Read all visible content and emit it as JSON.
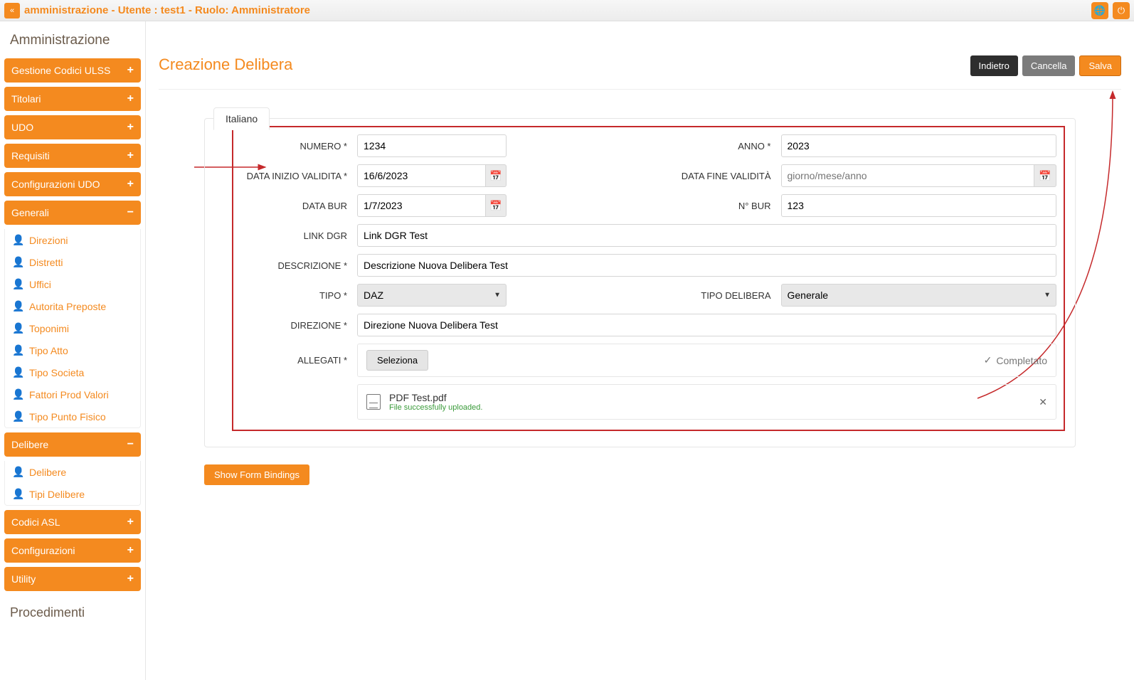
{
  "topbar": {
    "title": "amministrazione - Utente : test1 - Ruolo: Amministratore"
  },
  "sidebar": {
    "heading": "Amministrazione",
    "groups": [
      {
        "label": "Gestione Codici ULSS",
        "expanded": false
      },
      {
        "label": "Titolari",
        "expanded": false
      },
      {
        "label": "UDO",
        "expanded": false
      },
      {
        "label": "Requisiti",
        "expanded": false
      },
      {
        "label": "Configurazioni UDO",
        "expanded": false
      },
      {
        "label": "Generali",
        "expanded": true,
        "items": [
          "Direzioni",
          "Distretti",
          "Uffici",
          "Autorita Preposte",
          "Toponimi",
          "Tipo Atto",
          "Tipo Societa",
          "Fattori Prod Valori",
          "Tipo Punto Fisico"
        ]
      },
      {
        "label": "Delibere",
        "expanded": true,
        "items": [
          "Delibere",
          "Tipi Delibere"
        ]
      },
      {
        "label": "Codici ASL",
        "expanded": false
      },
      {
        "label": "Configurazioni",
        "expanded": false
      },
      {
        "label": "Utility",
        "expanded": false
      }
    ],
    "footer": "Procedimenti"
  },
  "page": {
    "title": "Creazione Delibera",
    "buttons": {
      "back": "Indietro",
      "cancel": "Cancella",
      "save": "Salva"
    },
    "tab": "Italiano",
    "show_bindings": "Show Form Bindings"
  },
  "form": {
    "labels": {
      "numero": "NUMERO *",
      "anno": "ANNO *",
      "data_inizio": "DATA INIZIO VALIDITA *",
      "data_fine": "DATA FINE VALIDITÀ",
      "data_bur": "DATA BUR",
      "n_bur": "N° BUR",
      "link_dgr": "LINK DGR",
      "descrizione": "DESCRIZIONE *",
      "tipo": "TIPO *",
      "tipo_delibera": "TIPO DELIBERA",
      "direzione": "DIREZIONE *",
      "allegati": "ALLEGATI *"
    },
    "values": {
      "numero": "1234",
      "anno": "2023",
      "data_inizio": "16/6/2023",
      "data_fine_placeholder": "giorno/mese/anno",
      "data_bur": "1/7/2023",
      "n_bur": "123",
      "link_dgr": "Link DGR Test",
      "descrizione": "Descrizione Nuova Delibera Test",
      "tipo": "DAZ",
      "tipo_delibera": "Generale",
      "direzione": "Direzione Nuova Delibera Test"
    },
    "upload": {
      "select_label": "Seleziona",
      "status": "Completato",
      "file_name": "PDF Test.pdf",
      "file_msg": "File successfully uploaded."
    }
  }
}
